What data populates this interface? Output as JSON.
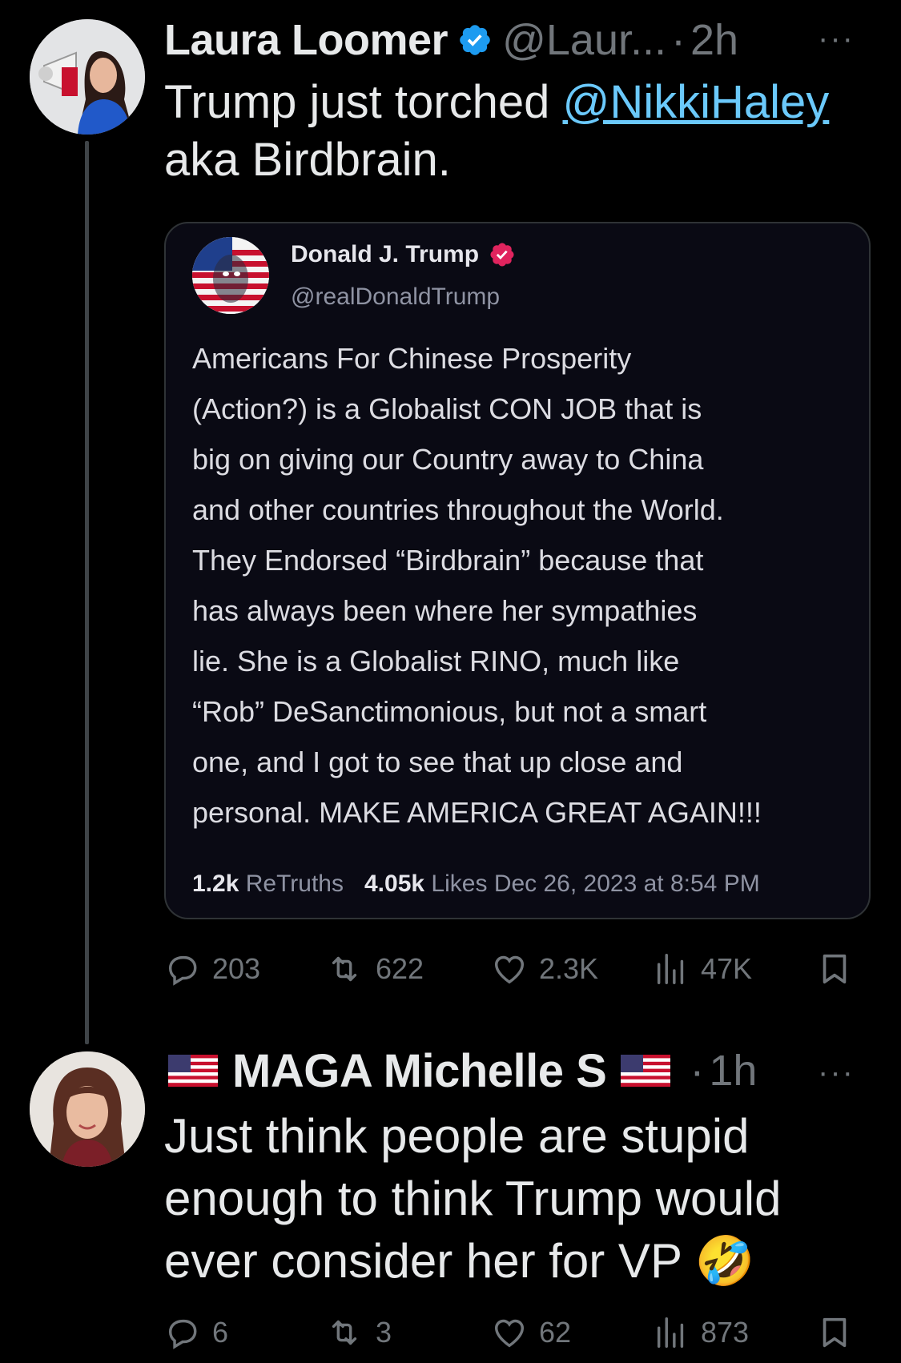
{
  "tweets": [
    {
      "author": {
        "name": "Laura Loomer",
        "handle": "@Laur...",
        "verified": true,
        "badge_color": "#1d9bf0"
      },
      "time": "2h",
      "text_parts": [
        "Trump just torched ",
        "@NikkiHaley",
        " aka Birdbrain."
      ],
      "quoted": {
        "author": {
          "name": "Donald J. Trump",
          "handle": "@realDonaldTrump",
          "badge_color": "#e0245e"
        },
        "body": "Americans For Chinese Prosperity\n(Action?) is a Globalist CON JOB that is\nbig on giving our  Country away to China\nand other countries throughout the World.\nThey Endorsed “Birdbrain” because that\nhas always been where her sympathies\nlie. She is a Globalist RINO, much like\n“Rob” DeSanctimonious, but not a smart\none, and I got to see that up close and\npersonal. MAKE AMERICA GREAT AGAIN!!!",
        "retruths_count": "1.2k",
        "retruths_label": "ReTruths",
        "likes_count": "4.05k",
        "likes_label": "Likes",
        "date": "Dec 26, 2023 at 8:54 PM"
      },
      "actions": {
        "replies": "203",
        "reposts": "622",
        "likes": "2.3K",
        "views": "47K"
      }
    },
    {
      "author": {
        "name": "MAGA Michelle S",
        "flag": "US flag",
        "verified": false
      },
      "time": "1h",
      "text": "Just think people are stupid enough to think Trump would ever consider her for VP",
      "emoji": "🤣",
      "actions": {
        "replies": "6",
        "reposts": "3",
        "likes": "62",
        "views": "873"
      }
    }
  ],
  "more_label": "···",
  "dot": "·",
  "icons": [
    "more-icon",
    "verified-badge-icon",
    "reply-icon",
    "repost-icon",
    "like-icon",
    "views-icon",
    "bookmark-icon",
    "us-flag-icon"
  ],
  "colors": {
    "background": "#000000",
    "text": "#e7e9ea",
    "muted": "#71767b",
    "link": "#6bc9fb",
    "thread_line": "#3f4448"
  }
}
